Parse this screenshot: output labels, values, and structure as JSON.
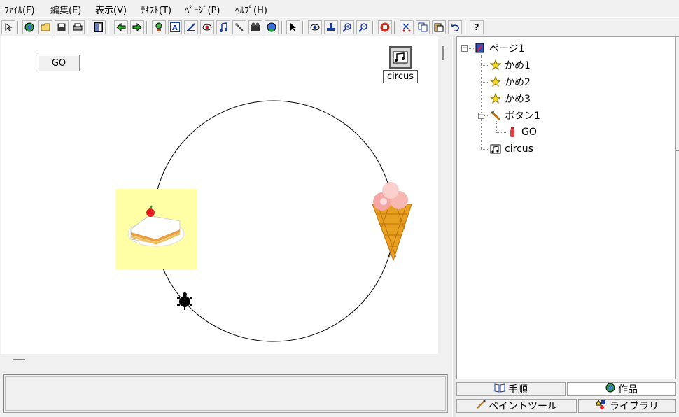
{
  "menu": {
    "file": "ﾌｧｲﾙ(F)",
    "edit": "編集(E)",
    "view": "表示(V)",
    "text": "ﾃｷｽﾄ(T)",
    "page": "ﾍﾟｰｼﾞ(P)",
    "help": "ﾍﾙﾌﾟ(H)"
  },
  "toolbar": {
    "icons": [
      "pointer-select",
      "globe",
      "open-folder",
      "save",
      "print",
      "layout",
      "back-arrow",
      "forward-arrow",
      "character",
      "text-box",
      "paint",
      "eye-record",
      "music-note",
      "pen",
      "film",
      "sound-globe",
      "arrow-cursor",
      "eye",
      "stamp",
      "zoom-in",
      "zoom-out",
      "stop-hand",
      "cut",
      "copy",
      "paste",
      "undo",
      "help"
    ],
    "help_label": "?"
  },
  "stage": {
    "go_button": "GO",
    "music_label": "circus",
    "background": "#ffffff",
    "cake_background": "#ffffa6"
  },
  "tree": {
    "page": "ページ1",
    "items": [
      {
        "label": "かめ1"
      },
      {
        "label": "かめ2"
      },
      {
        "label": "かめ3"
      }
    ],
    "button": "ボタン1",
    "button_child": "GO",
    "music": "circus"
  },
  "tabs": {
    "procedure": "手順",
    "works": "作品",
    "paint_tool": "ペイントツール",
    "library": "ライブラリ"
  }
}
